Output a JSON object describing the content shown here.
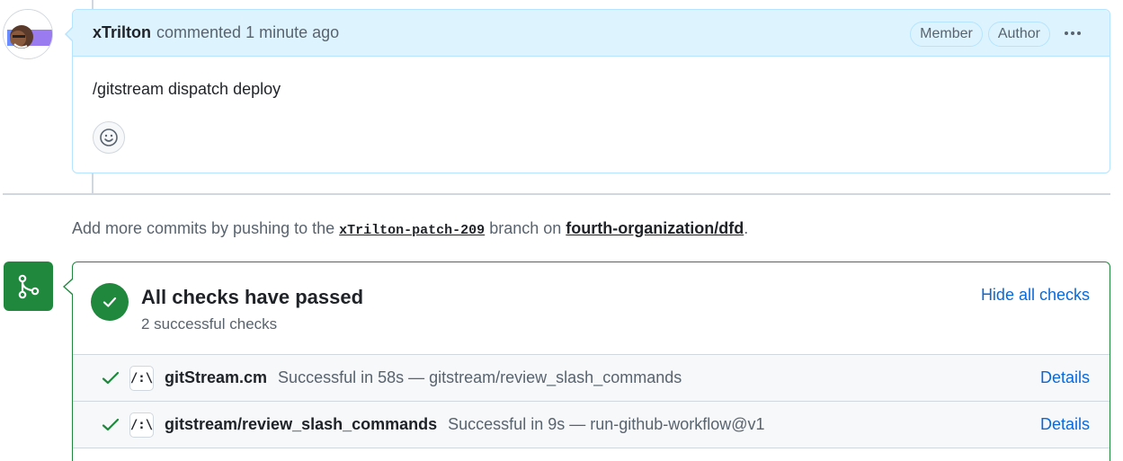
{
  "comment": {
    "author": "xTrilton",
    "action": "commented",
    "time": "1 minute ago",
    "badges": [
      "Member",
      "Author"
    ],
    "body": "/gitstream dispatch deploy",
    "icons": {
      "reaction": "smiley-icon",
      "menu": "kebab-icon"
    }
  },
  "push_note": {
    "prefix": "Add more commits by pushing to the",
    "branch": "xTrilton-patch-209",
    "middle": "branch on",
    "repo": "fourth-organization/dfd",
    "suffix": "."
  },
  "checks": {
    "title": "All checks have passed",
    "subtitle": "2 successful checks",
    "hide_label": "Hide all checks",
    "rows": [
      {
        "icon_text": "/:\\",
        "name": "gitStream.cm",
        "desc": "Successful in 58s — gitstream/review_slash_commands",
        "details": "Details"
      },
      {
        "icon_text": "/:\\",
        "name": "gitstream/review_slash_commands",
        "desc": "Successful in 9s — run-github-workflow@v1",
        "details": "Details"
      }
    ]
  },
  "colors": {
    "success": "#1f883d",
    "link": "#0969da",
    "comment_header_bg": "#ddf4ff"
  }
}
